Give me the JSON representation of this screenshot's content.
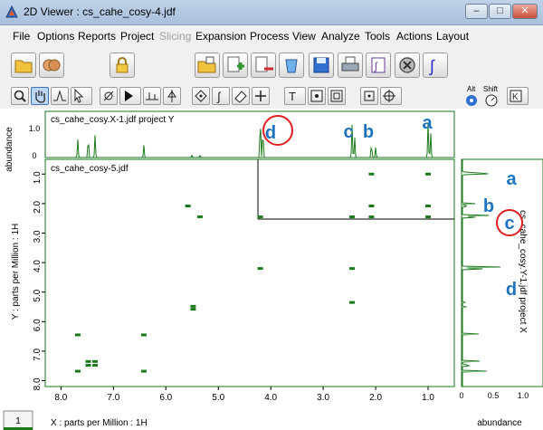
{
  "window": {
    "title": "2D Viewer : cs_cahe_cosy-4.jdf",
    "minimize_symbol": "–",
    "maximize_symbol": "□",
    "close_symbol": "✕"
  },
  "menu": [
    "File",
    "Options",
    "Reports",
    "Project",
    "Slicing",
    "Expansion",
    "Process",
    "View",
    "Analyze",
    "Tools",
    "Actions",
    "Layout"
  ],
  "menu_disabled": [
    "Slicing"
  ],
  "toolbar2_labels": {
    "alt": "Alt",
    "shift": "Shift"
  },
  "top_projection": {
    "title": "cs_cahe_cosy.X-1.jdf project Y",
    "axis_label": "abundance",
    "ticks": [
      "0",
      "1.0"
    ]
  },
  "side_projection": {
    "title": "cs_cahe_cosy.Y-1.jdf project X",
    "axis_label": "abundance",
    "ticks": [
      "0",
      "0.5",
      "1.0"
    ]
  },
  "main": {
    "title": "cs_cahe_cosy-5.jdf",
    "x_axis_label": "X : parts per Million : 1H",
    "y_axis_label": "Y : parts per Million : 1H",
    "x_ticks": [
      "8.0",
      "7.0",
      "6.0",
      "5.0",
      "4.0",
      "3.0",
      "2.0",
      "1.0"
    ],
    "y_ticks": [
      "1.0",
      "2.0",
      "3.0",
      "4.0",
      "5.0",
      "6.0",
      "7.0",
      "8.0"
    ]
  },
  "annotations": {
    "a": "a",
    "b": "b",
    "c": "c",
    "d": "d"
  },
  "status": {
    "page": "1"
  },
  "colors": {
    "spectrum": "#1a7a1a",
    "annotation": "#1e73be",
    "circle": "#e02020"
  },
  "chart_data": {
    "type": "scatter",
    "x": [
      1.0,
      1.0,
      1.0,
      2.08,
      2.08,
      2.08,
      2.45,
      2.45,
      2.45,
      4.2,
      4.2,
      5.48,
      5.48,
      5.35,
      7.68,
      7.68,
      7.48,
      7.48,
      7.35,
      7.35,
      6.42,
      6.42,
      5.58
    ],
    "y": [
      1.0,
      2.08,
      2.45,
      1.0,
      2.08,
      2.45,
      2.45,
      4.2,
      5.35,
      2.45,
      4.2,
      5.48,
      5.58,
      2.45,
      6.45,
      7.68,
      7.35,
      7.48,
      7.35,
      7.48,
      6.45,
      7.68,
      2.08
    ],
    "xlabel": "X : parts per Million : 1H",
    "ylabel": "Y : parts per Million : 1H",
    "xlim": [
      8.3,
      0.5
    ],
    "ylim": [
      0.5,
      8.2
    ]
  }
}
